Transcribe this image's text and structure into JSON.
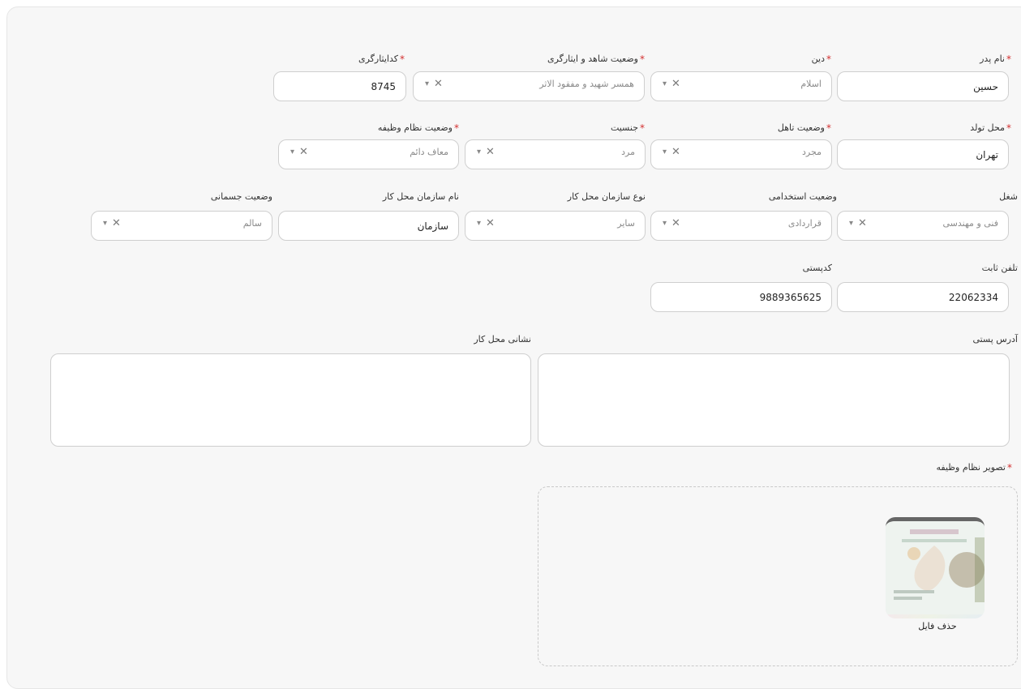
{
  "form": {
    "row1": {
      "father_name": {
        "label": "نام پدر",
        "required": true,
        "value": "حسین"
      },
      "religion": {
        "label": "دین",
        "required": true,
        "value": "اسلام"
      },
      "martyr_status": {
        "label": "وضعیت شاهد و ایثارگری",
        "required": true,
        "value": "همسر شهید و مفقود الاثر"
      },
      "isar_code": {
        "label": "کدایثارگری",
        "required": true,
        "value": "8745"
      }
    },
    "row2": {
      "birth_place": {
        "label": "محل تولد",
        "required": true,
        "value": "تهران"
      },
      "marital_status": {
        "label": "وضعیت تاهل",
        "required": true,
        "value": "مجرد"
      },
      "gender": {
        "label": "جنسیت",
        "required": true,
        "value": "مرد"
      },
      "military_status": {
        "label": "وضعیت نظام وظیفه",
        "required": true,
        "value": "معاف دائم"
      }
    },
    "row3": {
      "job": {
        "label": "شغل",
        "value": "فنی و مهندسی"
      },
      "employment_status": {
        "label": "وضعیت استخدامی",
        "value": "قراردادی"
      },
      "org_type": {
        "label": "نوع سازمان محل کار",
        "value": "سایر"
      },
      "org_name": {
        "label": "نام سازمان محل کار",
        "value": "سازمان"
      },
      "physical_status": {
        "label": "وضعیت جسمانی",
        "value": "سالم"
      }
    },
    "row4": {
      "landline": {
        "label": "تلفن ثابت",
        "value": "22062334"
      },
      "postal_code": {
        "label": "کدپستی",
        "value": "9889365625"
      }
    },
    "row5": {
      "postal_address": {
        "label": "آدرس پستی",
        "value": ""
      },
      "work_address": {
        "label": "نشانی محل کار",
        "value": ""
      }
    },
    "upload": {
      "label": "تصویر نظام وظیفه",
      "required": true,
      "delete_label": "حذف فایل",
      "thumbnail_icon": "military-card-image"
    },
    "icons": {
      "clear": "✕",
      "dropdown": "▾"
    },
    "colors": {
      "required": "#d32f2f",
      "border": "#cfcfcf",
      "background": "#f7f7f7"
    }
  }
}
